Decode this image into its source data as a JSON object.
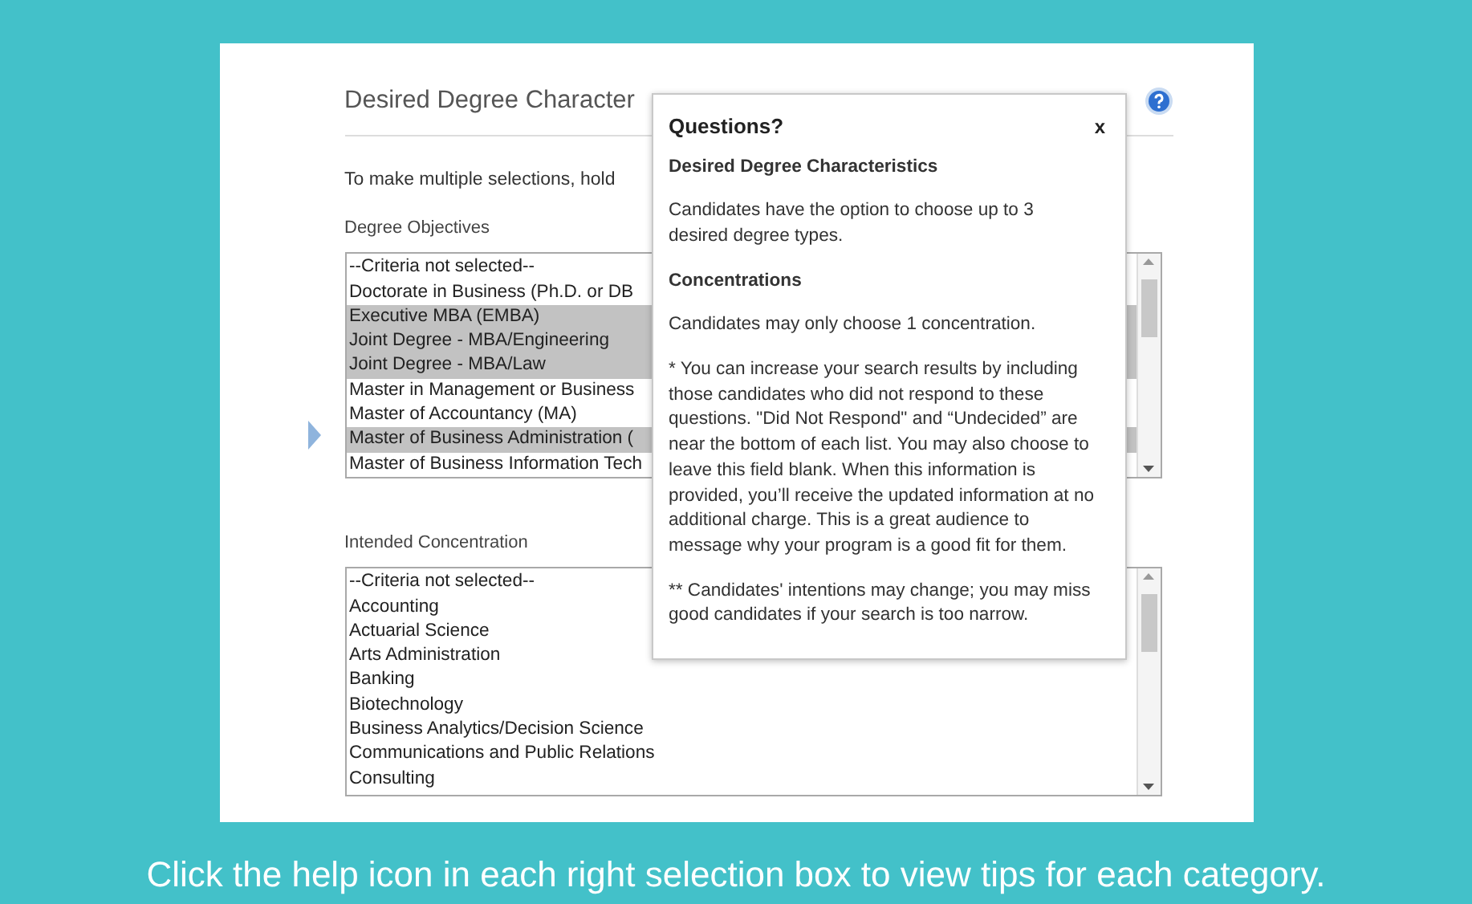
{
  "section": {
    "title": "Desired Degree Character",
    "instructions": "To make multiple selections, hold"
  },
  "lists": [
    {
      "label": "Degree Objectives",
      "items": [
        {
          "text": "--Criteria not selected--",
          "selected": false
        },
        {
          "text": "Doctorate in Business (Ph.D. or DB",
          "selected": false
        },
        {
          "text": "Executive MBA (EMBA)",
          "selected": true
        },
        {
          "text": "Joint Degree - MBA/Engineering",
          "selected": true
        },
        {
          "text": "Joint Degree - MBA/Law",
          "selected": true
        },
        {
          "text": "Master in Management or Business",
          "selected": false
        },
        {
          "text": "Master of Accountancy (MA)",
          "selected": false
        },
        {
          "text": "Master of Business Administration (",
          "selected": true
        },
        {
          "text": "Master of Business Information Tech",
          "selected": false
        }
      ]
    },
    {
      "label": "Intended Concentration",
      "items": [
        {
          "text": "--Criteria not selected--",
          "selected": false
        },
        {
          "text": "Accounting",
          "selected": false
        },
        {
          "text": "Actuarial Science",
          "selected": false
        },
        {
          "text": "Arts Administration",
          "selected": false
        },
        {
          "text": "Banking",
          "selected": false
        },
        {
          "text": "Biotechnology",
          "selected": false
        },
        {
          "text": "Business Analytics/Decision Science",
          "selected": false
        },
        {
          "text": "Communications and Public Relations",
          "selected": false
        },
        {
          "text": "Consulting",
          "selected": false
        }
      ]
    }
  ],
  "popover": {
    "title": "Questions?",
    "close": "x",
    "blocks": [
      {
        "kind": "heading",
        "text": "Desired Degree Characteristics"
      },
      {
        "kind": "text",
        "text": "Candidates have the option to choose up to 3 desired degree types."
      },
      {
        "kind": "heading",
        "text": "Concentrations"
      },
      {
        "kind": "text",
        "text": "Candidates may only choose 1 concentration."
      },
      {
        "kind": "text",
        "text": "* You can increase your search results by including those candidates who did not respond to these questions. \"Did Not Respond\" and “Undecided” are near the bottom of each list. You may also choose to leave this field blank. When this information is provided, you’ll receive the updated information at no additional charge. This is a great audience to message why your program is a good fit for them."
      },
      {
        "kind": "text",
        "text": "** Candidates' intentions may change; you may miss good candidates if your search is too narrow."
      }
    ]
  },
  "caption": "Click the help icon in each right selection box to view tips for each category."
}
